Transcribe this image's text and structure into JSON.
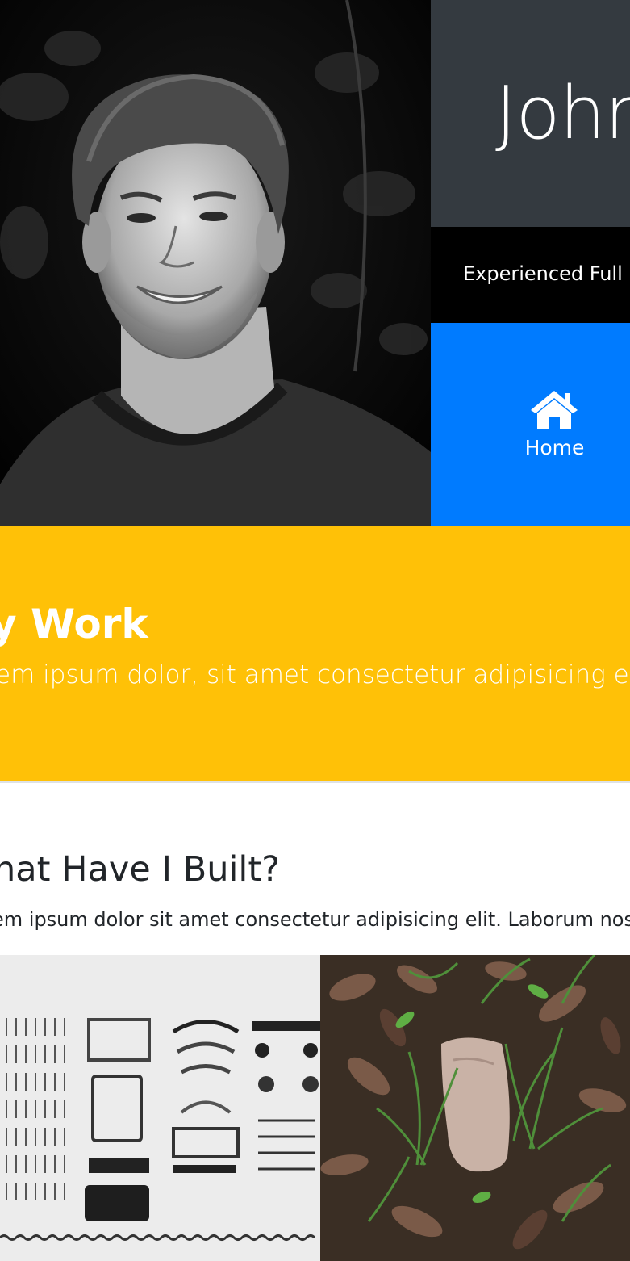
{
  "header": {
    "name": "John",
    "tagline": "Experienced Full S"
  },
  "nav": {
    "home_label": "Home",
    "home_icon": "home-icon"
  },
  "work": {
    "title": "y Work",
    "subtitle": "em ipsum dolor, sit amet consectetur adipisicing elit. Nihi"
  },
  "built": {
    "title": "hat Have I Built?",
    "text": "em ipsum dolor sit amet consectetur adipisicing elit. Laborum nostr"
  },
  "colors": {
    "name_bg": "#343a40",
    "tagline_bg": "#000000",
    "home_bg": "#007bff",
    "work_bg": "#ffc107"
  }
}
